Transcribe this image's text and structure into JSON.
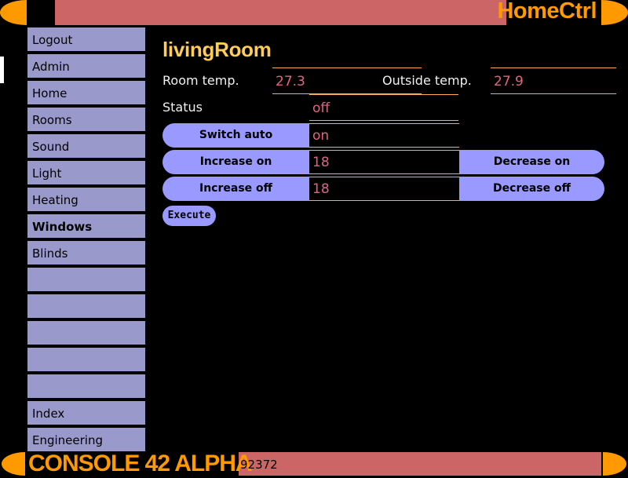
{
  "app": {
    "title": "HomeCtrl",
    "accent_orange": "#FF9900",
    "accent_salmon": "#CC6666",
    "panel_purple": "#9999CC",
    "button_purple": "#9999FF",
    "value_pink": "#DD6688",
    "title_gold": "#FFCC55",
    "field_border": "#FFAA55"
  },
  "sidebar": {
    "items": [
      {
        "label": "Logout",
        "bold": false
      },
      {
        "label": "Admin",
        "bold": false
      },
      {
        "label": "Home",
        "bold": false
      },
      {
        "label": "Rooms",
        "bold": false
      },
      {
        "label": "Sound",
        "bold": false
      },
      {
        "label": "Light",
        "bold": false
      },
      {
        "label": "Heating",
        "bold": false
      },
      {
        "label": "Windows",
        "bold": true
      },
      {
        "label": "Blinds",
        "bold": false
      },
      {
        "label": "",
        "bold": false
      },
      {
        "label": "",
        "bold": false
      },
      {
        "label": "",
        "bold": false
      },
      {
        "label": "",
        "bold": false
      },
      {
        "label": "",
        "bold": false
      },
      {
        "label": "Index",
        "bold": false
      },
      {
        "label": "Engineering",
        "bold": false
      }
    ]
  },
  "main": {
    "page_title": "livingRoom",
    "readouts": {
      "room_temp_label": "Room temp.",
      "room_temp_value": "27.3",
      "outside_temp_label": "Outside temp.",
      "outside_temp_value": "27.9",
      "status_label": "Status",
      "status_value": "off"
    },
    "actions": [
      {
        "left_label": "Switch auto",
        "value": "on",
        "right_label": "",
        "has_right": false
      },
      {
        "left_label": "Increase on",
        "value": "18",
        "right_label": "Decrease on",
        "has_right": true
      },
      {
        "left_label": "Increase off",
        "value": "18",
        "right_label": "Decrease off",
        "has_right": true
      }
    ],
    "execute_label": "Execute"
  },
  "statusbar": {
    "console_label": "CONSOLE 42 ALPHA",
    "console_code": "92372"
  }
}
